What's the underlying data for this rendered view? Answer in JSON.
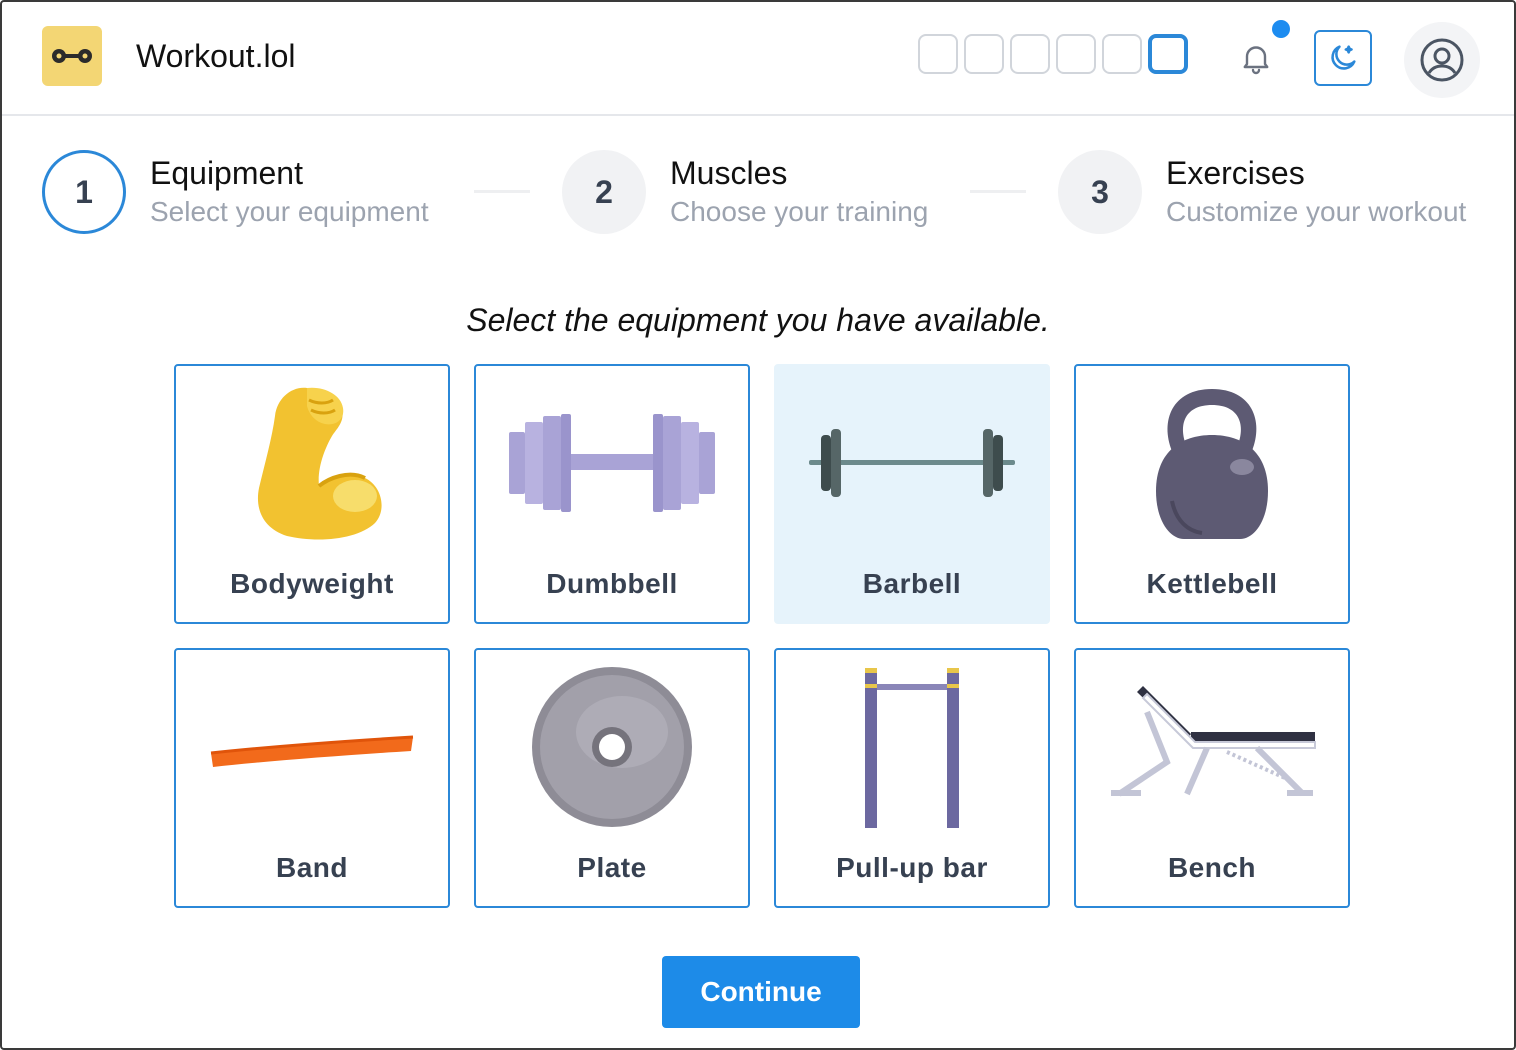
{
  "header": {
    "app_title": "Workout.lol",
    "logo_icon": "dumbbell-logo-icon",
    "theme_swatch_count": 6,
    "active_swatch_index": 5,
    "notification_icon": "bell-icon",
    "dark_mode_icon": "moon-icon",
    "profile_icon": "user-circle-icon",
    "accent_color": "#2b88d8",
    "logo_background": "#f3d674"
  },
  "stepper": {
    "steps": [
      {
        "number": "1",
        "title": "Equipment",
        "subtitle": "Select your equipment",
        "state": "current"
      },
      {
        "number": "2",
        "title": "Muscles",
        "subtitle": "Choose your training",
        "state": "upcoming"
      },
      {
        "number": "3",
        "title": "Exercises",
        "subtitle": "Customize your workout",
        "state": "upcoming"
      }
    ]
  },
  "main": {
    "prompt": "Select the equipment you have available.",
    "equipment": [
      {
        "label": "Bodyweight",
        "icon": "flexed-biceps-icon",
        "selected": false
      },
      {
        "label": "Dumbbell",
        "icon": "dumbbell-icon",
        "selected": false
      },
      {
        "label": "Barbell",
        "icon": "barbell-icon",
        "selected": true
      },
      {
        "label": "Kettlebell",
        "icon": "kettlebell-icon",
        "selected": false
      },
      {
        "label": "Band",
        "icon": "resistance-band-icon",
        "selected": false
      },
      {
        "label": "Plate",
        "icon": "weight-plate-icon",
        "selected": false
      },
      {
        "label": "Pull-up bar",
        "icon": "pullup-bar-icon",
        "selected": false
      },
      {
        "label": "Bench",
        "icon": "bench-icon",
        "selected": false
      }
    ],
    "continue_label": "Continue"
  }
}
